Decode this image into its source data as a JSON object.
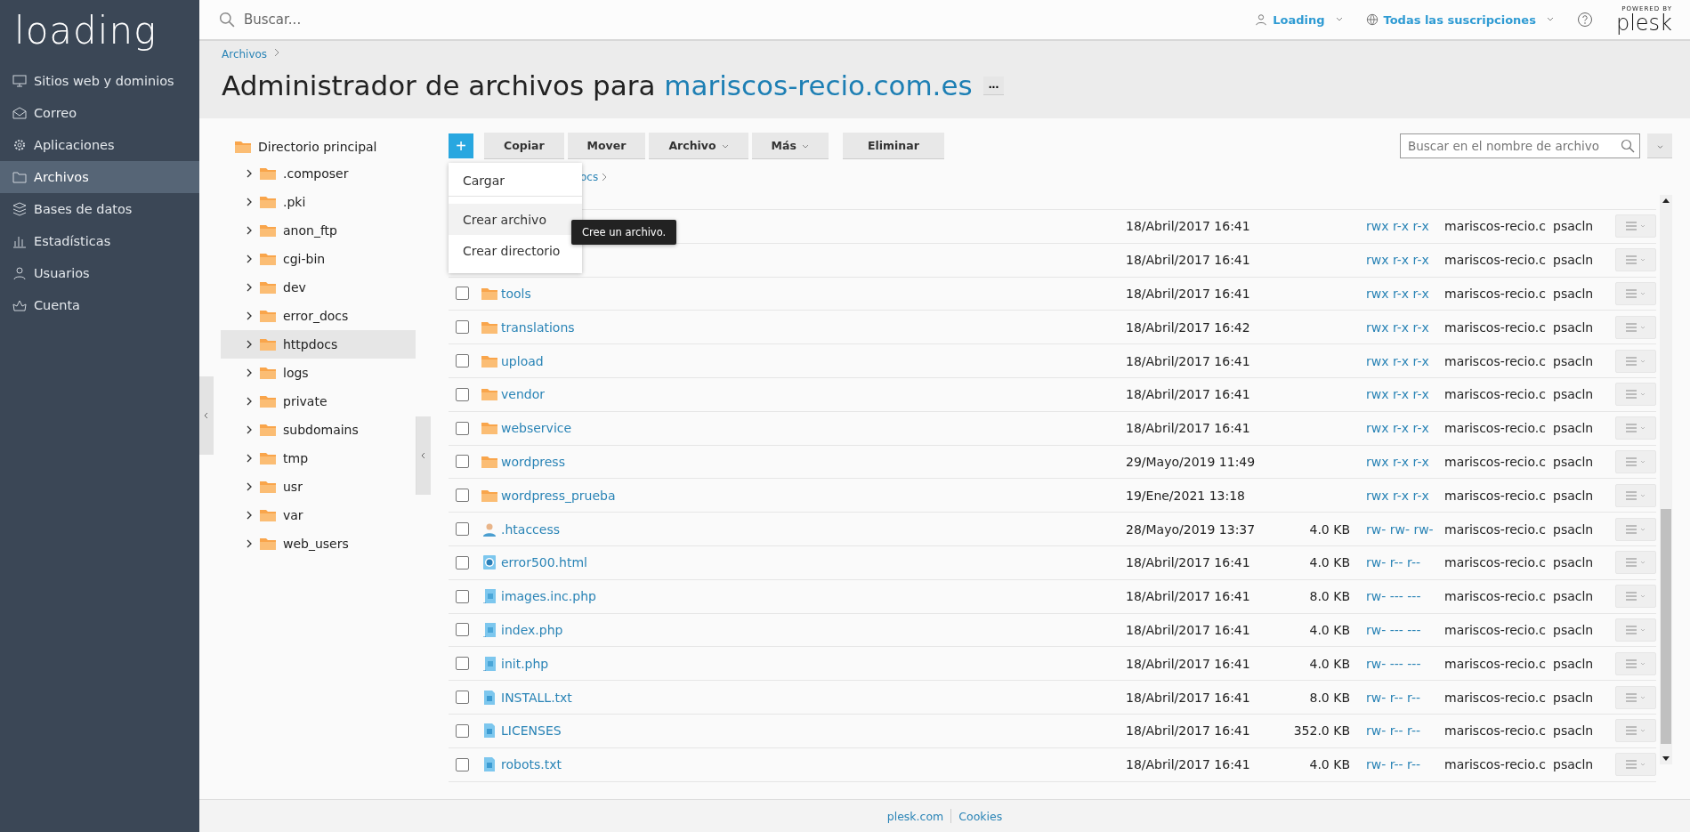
{
  "logo": "loading",
  "nav": [
    {
      "label": "Sitios web y dominios",
      "kind": "monitor",
      "selected": false
    },
    {
      "label": "Correo",
      "kind": "mail",
      "selected": false
    },
    {
      "label": "Aplicaciones",
      "kind": "gear",
      "selected": false
    },
    {
      "label": "Archivos",
      "kind": "folder",
      "selected": true
    },
    {
      "label": "Bases de datos",
      "kind": "db",
      "selected": false
    },
    {
      "label": "Estadísticas",
      "kind": "chart",
      "selected": false
    },
    {
      "label": "Usuarios",
      "kind": "user",
      "selected": false
    },
    {
      "label": "Cuenta",
      "kind": "account",
      "selected": false
    }
  ],
  "topbar": {
    "search_placeholder": "Buscar...",
    "user": "Loading",
    "subscriptions": "Todas las suscripciones",
    "powered_by": "POWERED BY",
    "brand": "plesk"
  },
  "breadcrumb": "Archivos",
  "title": {
    "prefix": "Administrador de archivos para",
    "domain": "mariscos-recio.com.es",
    "more": "..."
  },
  "tree": {
    "label": "Directorio principal",
    "children": [
      {
        "label": ".composer",
        "selected": false
      },
      {
        "label": ".pki",
        "selected": false
      },
      {
        "label": "anon_ftp",
        "selected": false
      },
      {
        "label": "cgi-bin",
        "selected": false
      },
      {
        "label": "dev",
        "selected": false
      },
      {
        "label": "error_docs",
        "selected": false
      },
      {
        "label": "httpdocs",
        "selected": true
      },
      {
        "label": "logs",
        "selected": false
      },
      {
        "label": "private",
        "selected": false
      },
      {
        "label": "subdomains",
        "selected": false
      },
      {
        "label": "tmp",
        "selected": false
      },
      {
        "label": "usr",
        "selected": false
      },
      {
        "label": "var",
        "selected": false
      },
      {
        "label": "web_users",
        "selected": false
      }
    ]
  },
  "toolbar": {
    "add": "+",
    "buttons": [
      {
        "label": "Copiar",
        "caret": false
      },
      {
        "label": "Mover",
        "caret": false
      },
      {
        "label": "Archivo",
        "caret": true
      },
      {
        "label": "Más",
        "caret": true
      },
      {
        "label": "Eliminar",
        "caret": false
      }
    ],
    "search_placeholder": "Buscar en el nombre de archivo"
  },
  "path": "ocs",
  "add_menu": [
    {
      "label": "Cargar",
      "highlighted": false
    },
    {
      "label": "Crear archivo",
      "highlighted": true
    },
    {
      "label": "Crear directorio",
      "highlighted": false
    }
  ],
  "tooltip": "Cree un archivo.",
  "rows": [
    {
      "kind": "hidden",
      "date": "18/Abril/2017 16:41",
      "perms": "rwx r-x r-x",
      "owner": "mariscos-recio.c",
      "group": "psacln"
    },
    {
      "kind": "hidden",
      "date": "18/Abril/2017 16:41",
      "perms": "rwx r-x r-x",
      "owner": "mariscos-recio.c",
      "group": "psacln"
    },
    {
      "kind": "folder",
      "name": "tools",
      "date": "18/Abril/2017 16:41",
      "size": "",
      "perms": "rwx r-x r-x",
      "owner": "mariscos-recio.c",
      "group": "psacln",
      "checked": false
    },
    {
      "kind": "folder",
      "name": "translations",
      "date": "18/Abril/2017 16:42",
      "size": "",
      "perms": "rwx r-x r-x",
      "owner": "mariscos-recio.c",
      "group": "psacln",
      "checked": false
    },
    {
      "kind": "folder",
      "name": "upload",
      "date": "18/Abril/2017 16:41",
      "size": "",
      "perms": "rwx r-x r-x",
      "owner": "mariscos-recio.c",
      "group": "psacln",
      "checked": false
    },
    {
      "kind": "folder",
      "name": "vendor",
      "date": "18/Abril/2017 16:41",
      "size": "",
      "perms": "rwx r-x r-x",
      "owner": "mariscos-recio.c",
      "group": "psacln",
      "checked": false
    },
    {
      "kind": "folder",
      "name": "webservice",
      "date": "18/Abril/2017 16:41",
      "size": "",
      "perms": "rwx r-x r-x",
      "owner": "mariscos-recio.c",
      "group": "psacln",
      "checked": false
    },
    {
      "kind": "folder",
      "name": "wordpress",
      "date": "29/Mayo/2019 11:49",
      "size": "",
      "perms": "rwx r-x r-x",
      "owner": "mariscos-recio.c",
      "group": "psacln",
      "checked": false
    },
    {
      "kind": "folder",
      "name": "wordpress_prueba",
      "date": "19/Ene/2021 13:18",
      "size": "",
      "perms": "rwx r-x r-x",
      "owner": "mariscos-recio.c",
      "group": "psacln",
      "checked": false
    },
    {
      "kind": "user",
      "name": ".htaccess",
      "date": "28/Mayo/2019 13:37",
      "size": "4.0 KB",
      "perms": "rw- rw- rw-",
      "owner": "mariscos-recio.c",
      "group": "psacln",
      "checked": false
    },
    {
      "kind": "web",
      "name": "error500.html",
      "date": "18/Abril/2017 16:41",
      "size": "4.0 KB",
      "perms": "rw- r-- r--",
      "owner": "mariscos-recio.c",
      "group": "psacln",
      "checked": false
    },
    {
      "kind": "script",
      "name": "images.inc.php",
      "date": "18/Abril/2017 16:41",
      "size": "8.0 KB",
      "perms": "rw- --- ---",
      "owner": "mariscos-recio.c",
      "group": "psacln",
      "checked": false
    },
    {
      "kind": "script",
      "name": "index.php",
      "date": "18/Abril/2017 16:41",
      "size": "4.0 KB",
      "perms": "rw- --- ---",
      "owner": "mariscos-recio.c",
      "group": "psacln",
      "checked": false
    },
    {
      "kind": "script",
      "name": "init.php",
      "date": "18/Abril/2017 16:41",
      "size": "4.0 KB",
      "perms": "rw- --- ---",
      "owner": "mariscos-recio.c",
      "group": "psacln",
      "checked": false
    },
    {
      "kind": "text",
      "name": "INSTALL.txt",
      "date": "18/Abril/2017 16:41",
      "size": "8.0 KB",
      "perms": "rw- r-- r--",
      "owner": "mariscos-recio.c",
      "group": "psacln",
      "checked": false
    },
    {
      "kind": "text",
      "name": "LICENSES",
      "date": "18/Abril/2017 16:41",
      "size": "352.0 KB",
      "perms": "rw- r-- r--",
      "owner": "mariscos-recio.c",
      "group": "psacln",
      "checked": false
    },
    {
      "kind": "text",
      "name": "robots.txt",
      "date": "18/Abril/2017 16:41",
      "size": "4.0 KB",
      "perms": "rw- r-- r--",
      "owner": "mariscos-recio.c",
      "group": "psacln",
      "checked": false
    }
  ],
  "footer": [
    "plesk.com",
    "Cookies"
  ]
}
